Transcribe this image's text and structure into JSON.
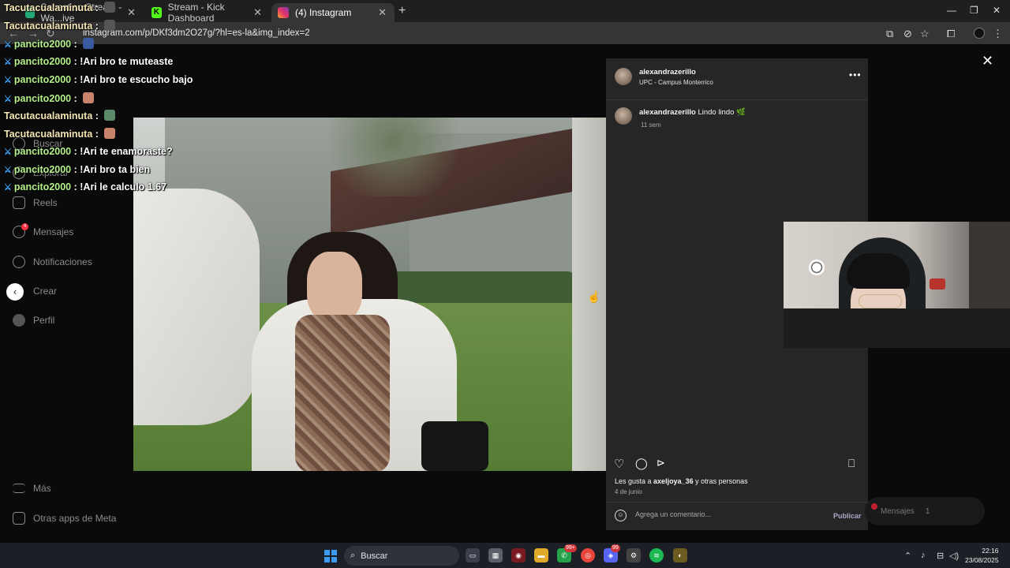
{
  "browser": {
    "tabs": [
      {
        "label": "Sebastian Stream - Wa...ive",
        "active": false
      },
      {
        "label": "Stream - Kick Dashboard",
        "active": false
      },
      {
        "label": "(4) Instagram",
        "active": true
      }
    ],
    "url": "instagram.com/p/DKf3dm2O27g/?hl=es-la&img_index=2"
  },
  "sidebar": {
    "bg_logo": "Instagram",
    "items": [
      {
        "label": "Buscar",
        "icon": "search-icon"
      },
      {
        "label": "Explorar",
        "icon": "compass-icon"
      },
      {
        "label": "Reels",
        "icon": "reels-icon"
      },
      {
        "label": "Mensajes",
        "icon": "messenger-icon",
        "badge": "4"
      },
      {
        "label": "Notificaciones",
        "icon": "heart-icon"
      },
      {
        "label": "Crear",
        "icon": "plus-icon"
      },
      {
        "label": "Perfil",
        "icon": "avatar"
      },
      {
        "label": "Más",
        "icon": "menu-icon"
      },
      {
        "label": "Otras apps de Meta",
        "icon": "meta-icon"
      }
    ]
  },
  "post": {
    "username": "alexandrazerillo",
    "location": "UPC - Campus Monterrico",
    "caption_user": "alexandrazerillo",
    "caption": "Lindo lindo 🌿",
    "caption_time": "11 sem",
    "likes_prefix": "Les gusta a ",
    "likes_user": "axeljoya_36",
    "likes_suffix": " y otras personas",
    "date": "4 de junio",
    "comment_placeholder": "Agrega un comentario...",
    "publish_label": "Publicar"
  },
  "messages_pill": {
    "label": "Mensajes",
    "count": "1"
  },
  "chat": [
    {
      "user": "Tacutacualaminuta",
      "text": "",
      "mod": false,
      "emote": "#555"
    },
    {
      "user": "Tacutacualaminuta",
      "text": "",
      "mod": false,
      "emote": "#555"
    },
    {
      "user": "pancito2000",
      "text": "",
      "mod": true,
      "emote": "#3a5aa0"
    },
    {
      "user": "pancito2000",
      "text": "!Ari bro te muteaste",
      "mod": true
    },
    {
      "user": "pancito2000",
      "text": "!Ari bro te escucho bajo",
      "mod": true
    },
    {
      "user": "pancito2000",
      "text": "",
      "mod": true,
      "emote": "#c8836a"
    },
    {
      "user": "Tacutacualaminuta",
      "text": "",
      "mod": false,
      "emote": "#5a8a6a"
    },
    {
      "user": "Tacutacualaminuta",
      "text": "",
      "mod": false,
      "emote": "#c8836a"
    },
    {
      "user": "pancito2000",
      "text": "!Ari te enamoraste?",
      "mod": true
    },
    {
      "user": "pancito2000",
      "text": "!Ari bro ta bien",
      "mod": true
    },
    {
      "user": "pancito2000",
      "text": "!Ari le calculo 1.67",
      "mod": true
    }
  ],
  "taskbar": {
    "search_label": "Buscar",
    "whatsapp_badge": "99+",
    "discord_badge": "99",
    "time": "22:16",
    "date": "23/08/2025"
  },
  "colors": {
    "instagram_bg": "#0a0a0a",
    "panel_bg": "#262626",
    "mod_badge": "#45a6ff",
    "mod_user": "#b6f28c"
  }
}
